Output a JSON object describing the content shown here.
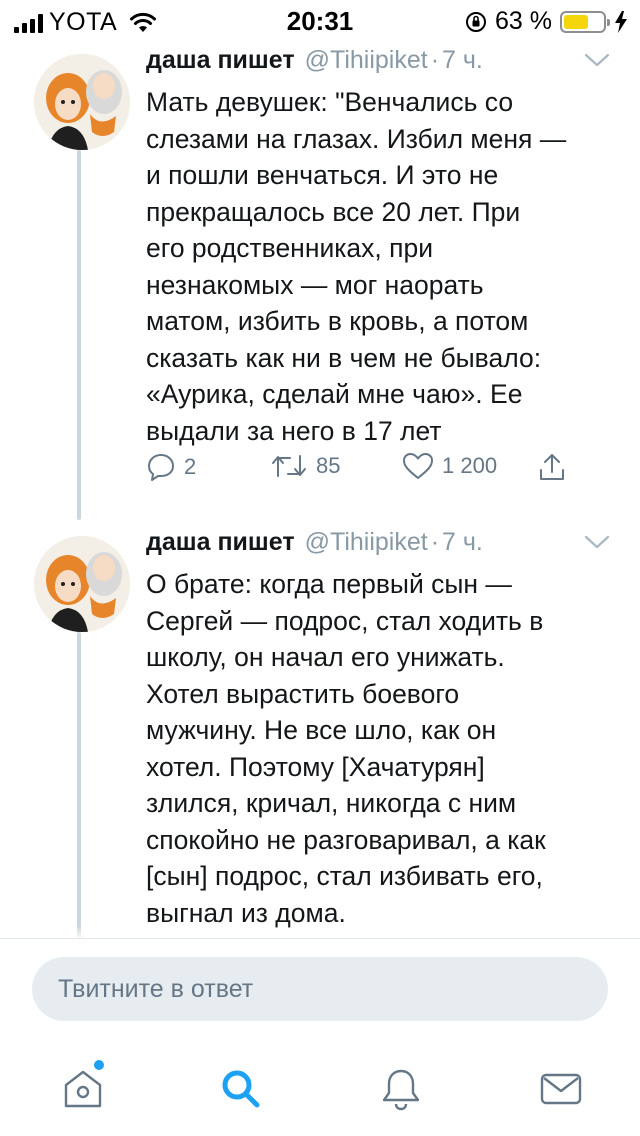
{
  "status_bar": {
    "carrier": "YOTA",
    "time": "20:31",
    "battery_percent_label": "63 %",
    "battery_level": 0.63,
    "battery_color": "#f5d50b"
  },
  "tweets": [
    {
      "author_name": "даша пишет",
      "handle": "@Tihiipiket",
      "separator": "·",
      "time": "7 ч.",
      "text": "Мать девушек: \"Венчались со\nслезами на глазах. Избил меня —\nи пошли венчаться. И это не\nпрекращалось все 20 лет. При\nего родственниках, при\nнезнакомых — мог наорать\nматом, избить в кровь, а потом\nсказать как ни в чем не бывало:\n«Аурика, сделай мне чаю». Ее\nвыдали за него в 17 лет",
      "replies": "2",
      "retweets": "85",
      "likes": "1 200"
    },
    {
      "author_name": "даша пишет",
      "handle": "@Tihiipiket",
      "separator": "·",
      "time": "7 ч.",
      "text": "О брате: когда первый сын —\nСергей — подрос, стал ходить в\nшколу, он начал его унижать.\nХотел вырастить боевого\nмужчину. Не все шло, как он\nхотел. Поэтому [Хачатурян]\nзлился, кричал, никогда с ним\nспокойно не разговаривал, а как\n[сын] подрос, стал избивать его,\nвыгнал из дома."
    }
  ],
  "reply": {
    "placeholder": "Твитните в ответ"
  },
  "tab_bar": {
    "tabs": [
      {
        "icon": "home-icon",
        "has_notification": true
      },
      {
        "icon": "search-icon",
        "active": true
      },
      {
        "icon": "bell-icon"
      },
      {
        "icon": "mail-icon"
      }
    ],
    "accent_color": "#1da1f2"
  }
}
